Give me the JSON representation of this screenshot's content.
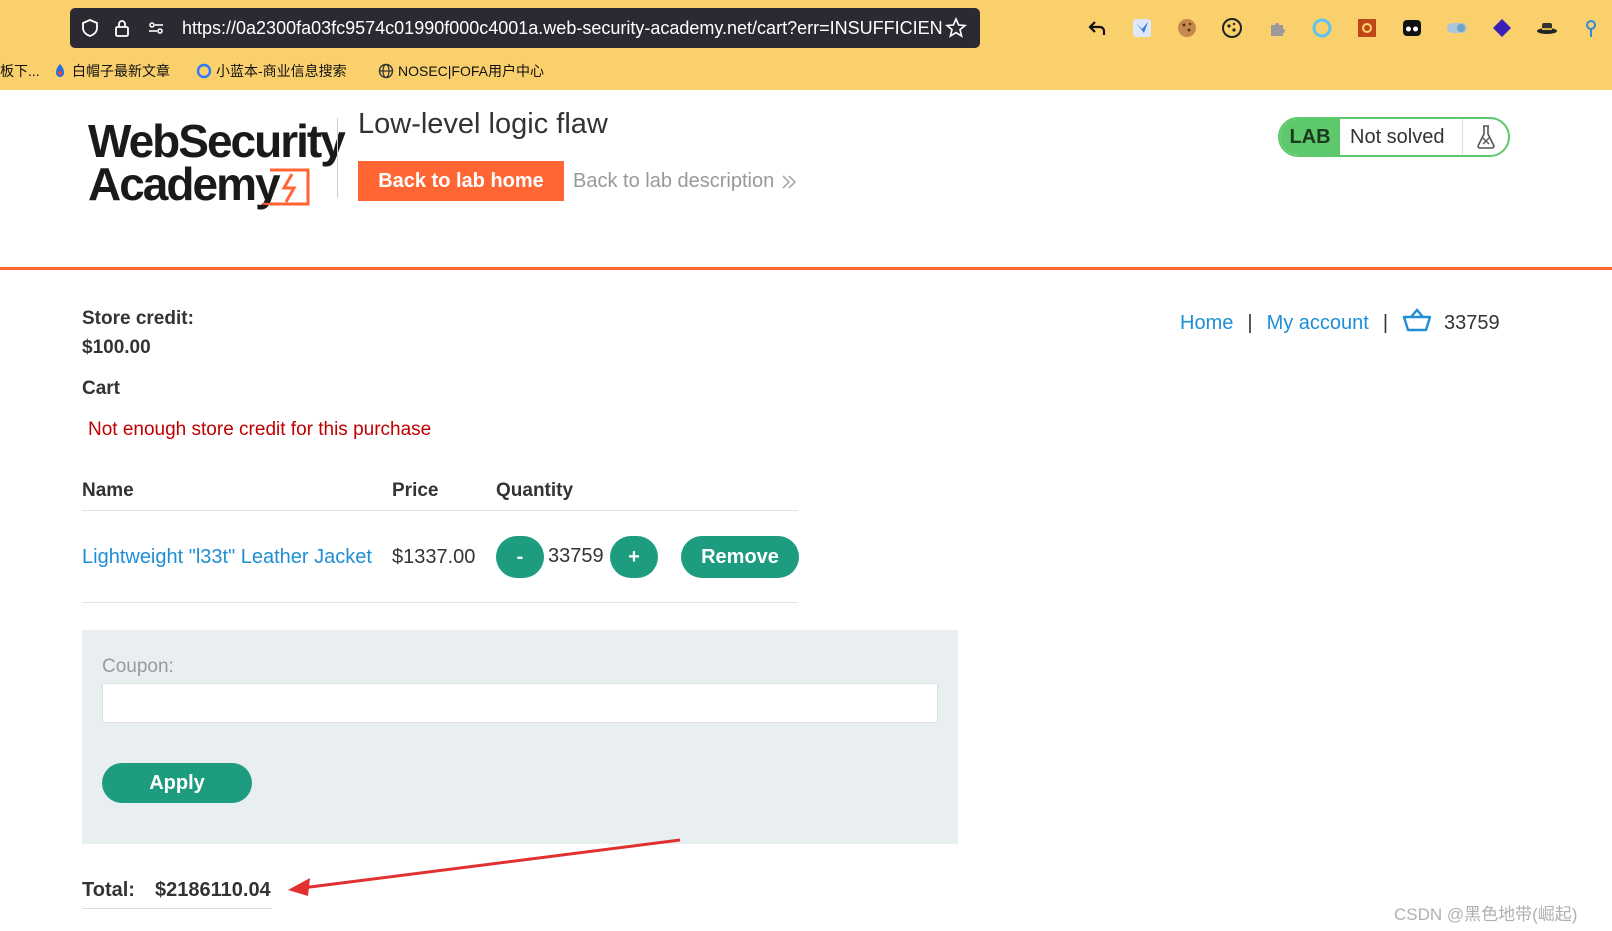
{
  "browser": {
    "url": "https://0a2300fa03fc9574c01990f000c4001a.web-security-academy.net/cart?err=INSUFFICIENT",
    "bookmarks": [
      "板下...",
      "白帽子最新文章",
      "小蓝本-商业信息搜索",
      "NOSEC|FOFA用户中心"
    ],
    "extension_icons": [
      "back-arrow-icon",
      "bird-icon",
      "cookie-icon",
      "cookie-editor-icon",
      "puzzle-icon",
      "circle-icon",
      "gear-box-icon",
      "glasses-icon",
      "toggle-icon",
      "cube-icon",
      "hat-icon",
      "pin-icon"
    ]
  },
  "header": {
    "logo_line1": "WebSecurity",
    "logo_line2": "Academy",
    "lab_title": "Low-level logic flaw",
    "back_home": "Back to lab home",
    "back_description": "Back to lab description",
    "status_badge": "LAB",
    "status_text": "Not solved"
  },
  "nav": {
    "home": "Home",
    "separator": "|",
    "my_account": "My account",
    "cart_count": "33759"
  },
  "account": {
    "credit_label": "Store credit:",
    "credit_value": "$100.00"
  },
  "cart": {
    "heading": "Cart",
    "error": "Not enough store credit for this purchase",
    "columns": [
      "Name",
      "Price",
      "Quantity"
    ],
    "items": [
      {
        "name": "Lightweight \"l33t\" Leather Jacket",
        "price": "$1337.00",
        "quantity": "33759",
        "minus": "-",
        "plus": "+",
        "remove": "Remove"
      }
    ],
    "coupon_label": "Coupon:",
    "coupon_value": "",
    "apply": "Apply",
    "total_label": "Total:",
    "total_value": "$2186110.04"
  },
  "colors": {
    "browser_bar": "#f9d06c",
    "accent_orange": "#ff6633",
    "button_green": "#1d9c80",
    "link_blue": "#1f8ed6",
    "error_red": "#c00000",
    "lab_green": "#5ec96c"
  },
  "watermark": "CSDN @黑色地带(崛起)"
}
